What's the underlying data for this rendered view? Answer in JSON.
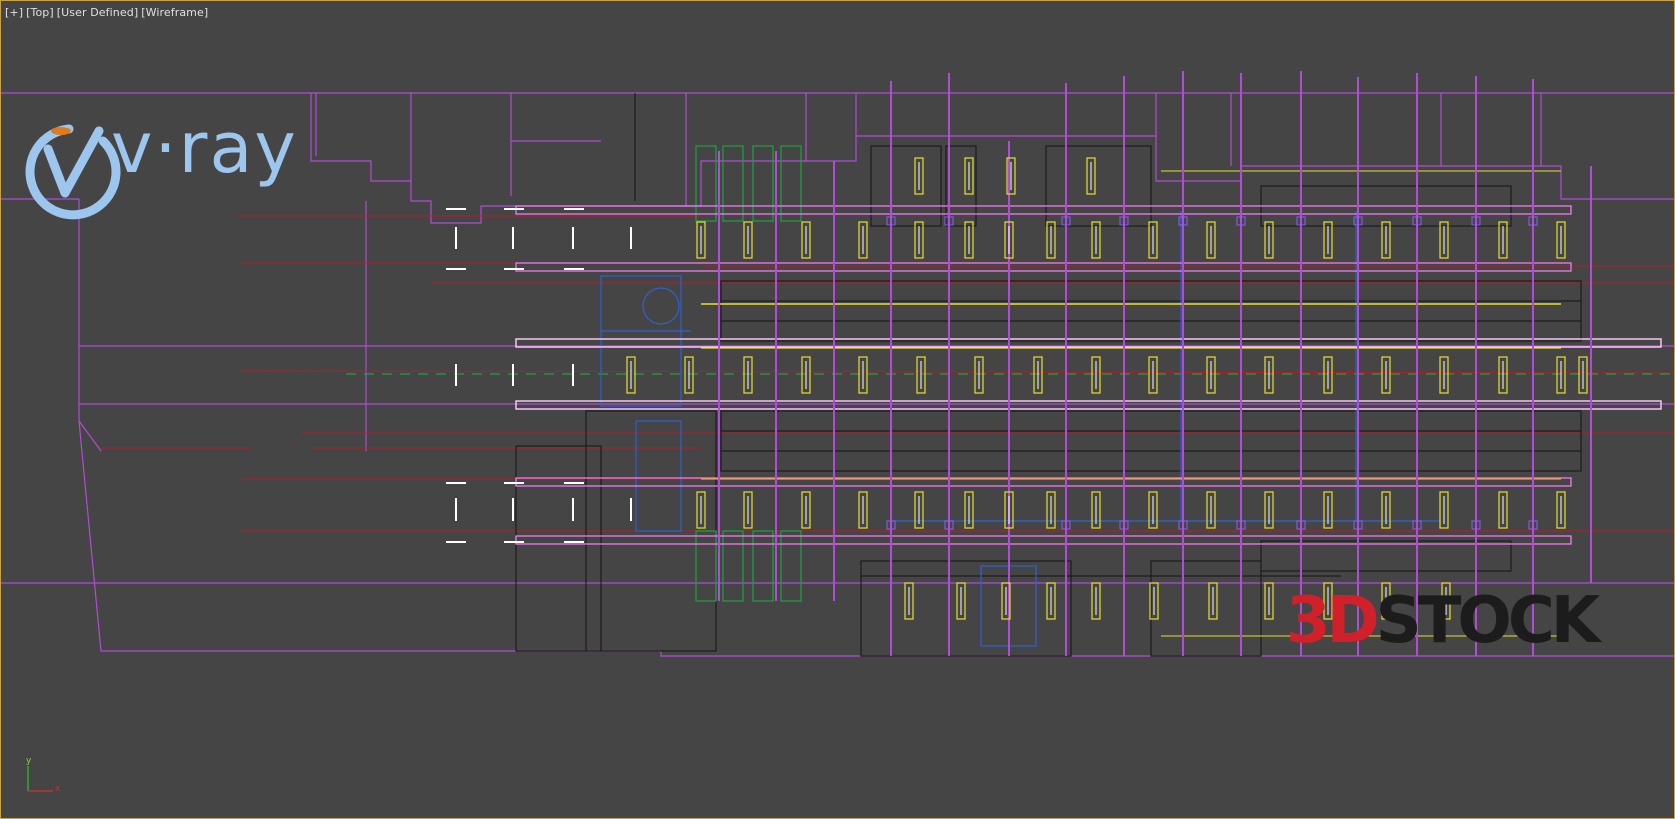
{
  "viewport": {
    "labels": [
      "[+]",
      "[Top]",
      "[User Defined]",
      "[Wireframe]"
    ],
    "frame_color": "#c8a24a",
    "background": "#454545"
  },
  "watermarks": {
    "vray": "v·ray",
    "stock_prefix": "3D",
    "stock_suffix": "STOCK"
  },
  "axis": {
    "y_label": "y",
    "x_label": "x"
  },
  "colors": {
    "wall": "#b04cd6",
    "wall_bright": "#d873ff",
    "line_red": "#b0202a",
    "line_yellow": "#e8e030",
    "line_blue": "#3060d0",
    "line_green": "#20a040",
    "line_black": "#141414",
    "line_white": "#ffffff"
  }
}
